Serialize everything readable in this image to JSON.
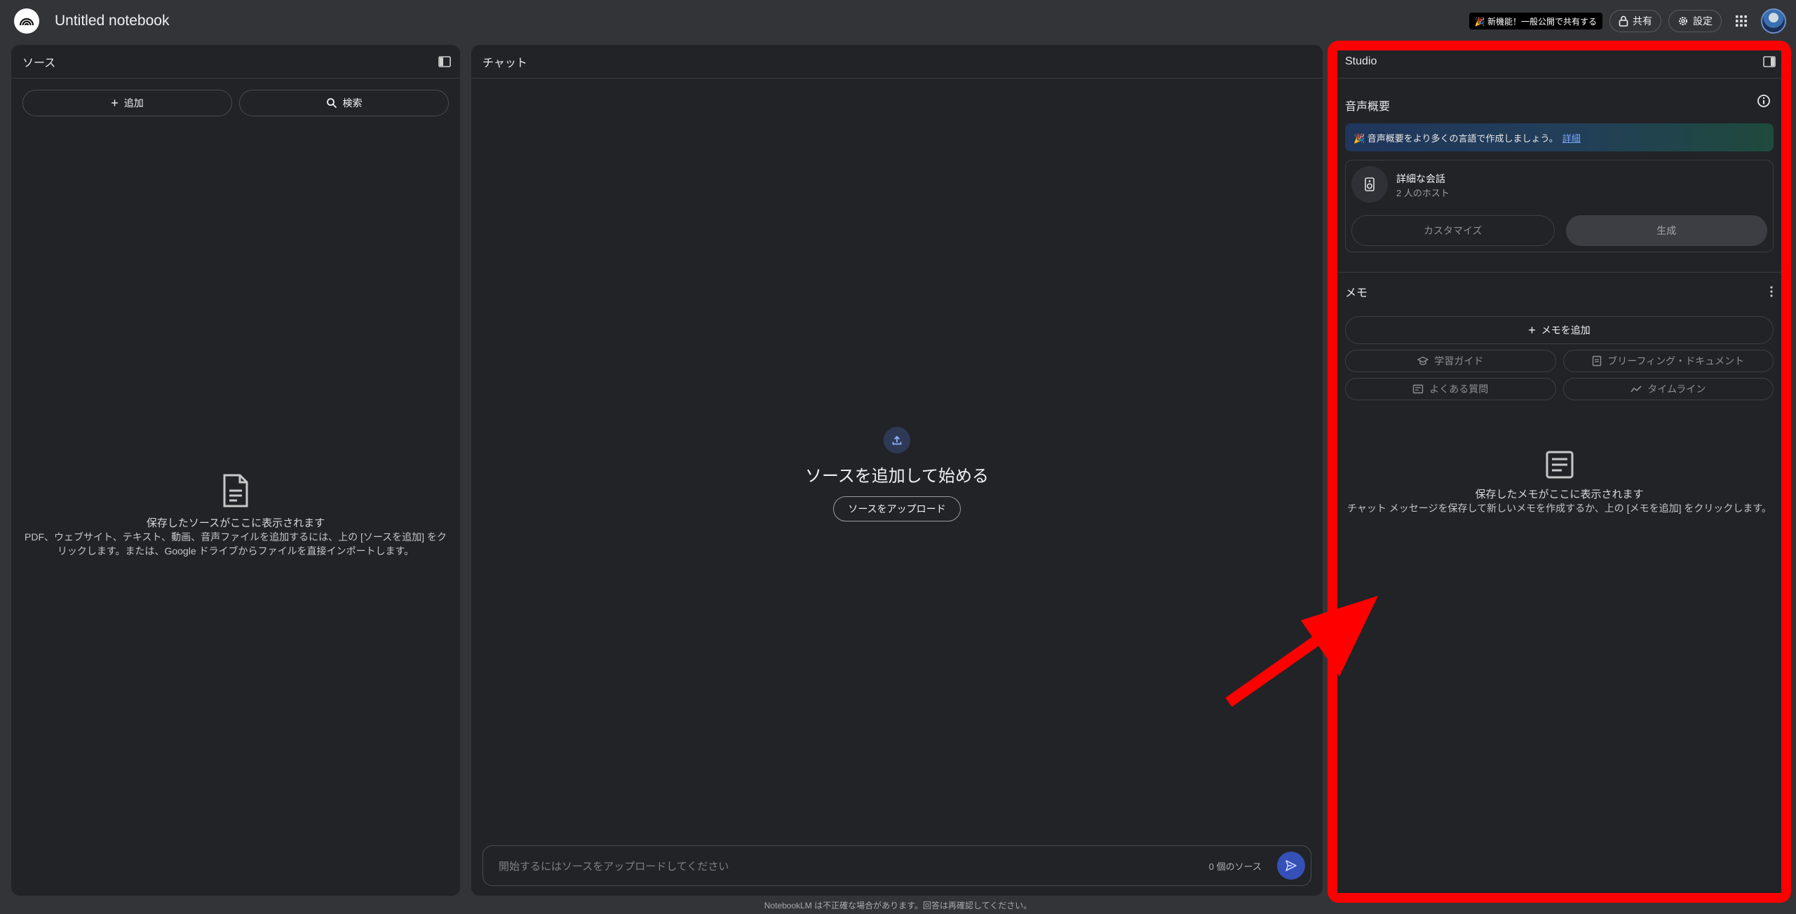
{
  "app": {
    "title": "Untitled notebook"
  },
  "topbar": {
    "promo": "🎉 新機能！一般公開で共有する",
    "share_label": "共有",
    "settings_label": "設定"
  },
  "sources": {
    "title": "ソース",
    "add_label": "追加",
    "search_label": "検索",
    "empty_title": "保存したソースがここに表示されます",
    "empty_desc": "PDF、ウェブサイト、テキスト、動画、音声ファイルを追加するには、上の [ソースを追加] をクリックします。または、Google ドライブからファイルを直接インポートします。"
  },
  "chat": {
    "title": "チャット",
    "heading": "ソースを追加して始める",
    "upload_label": "ソースをアップロード",
    "input_placeholder": "開始するにはソースをアップロードしてください",
    "source_count": "0 個のソース"
  },
  "studio": {
    "title": "Studio",
    "audio_title": "音声概要",
    "banner_text": "🎉 音声概要をより多くの言語で作成しましょう。",
    "banner_link": "詳細",
    "card_title": "詳細な会話",
    "card_sub": "2 人のホスト",
    "customize_label": "カスタマイズ",
    "generate_label": "生成",
    "memo_title": "メモ",
    "add_memo_label": "メモを追加",
    "chips": [
      {
        "label": "学習ガイド",
        "icon": "graduation-cap-icon"
      },
      {
        "label": "ブリーフィング・ドキュメント",
        "icon": "document-icon"
      },
      {
        "label": "よくある質問",
        "icon": "faq-icon"
      },
      {
        "label": "タイムライン",
        "icon": "timeline-icon"
      }
    ],
    "empty_title": "保存したメモがここに表示されます",
    "empty_desc": "チャット メッセージを保存して新しいメモを作成するか、上の [メモを追加] をクリックします。"
  },
  "footer": {
    "note": "NotebookLM は不正確な場合があります。回答は再確認してください。"
  },
  "annotation": {
    "color": "#ff0000"
  }
}
